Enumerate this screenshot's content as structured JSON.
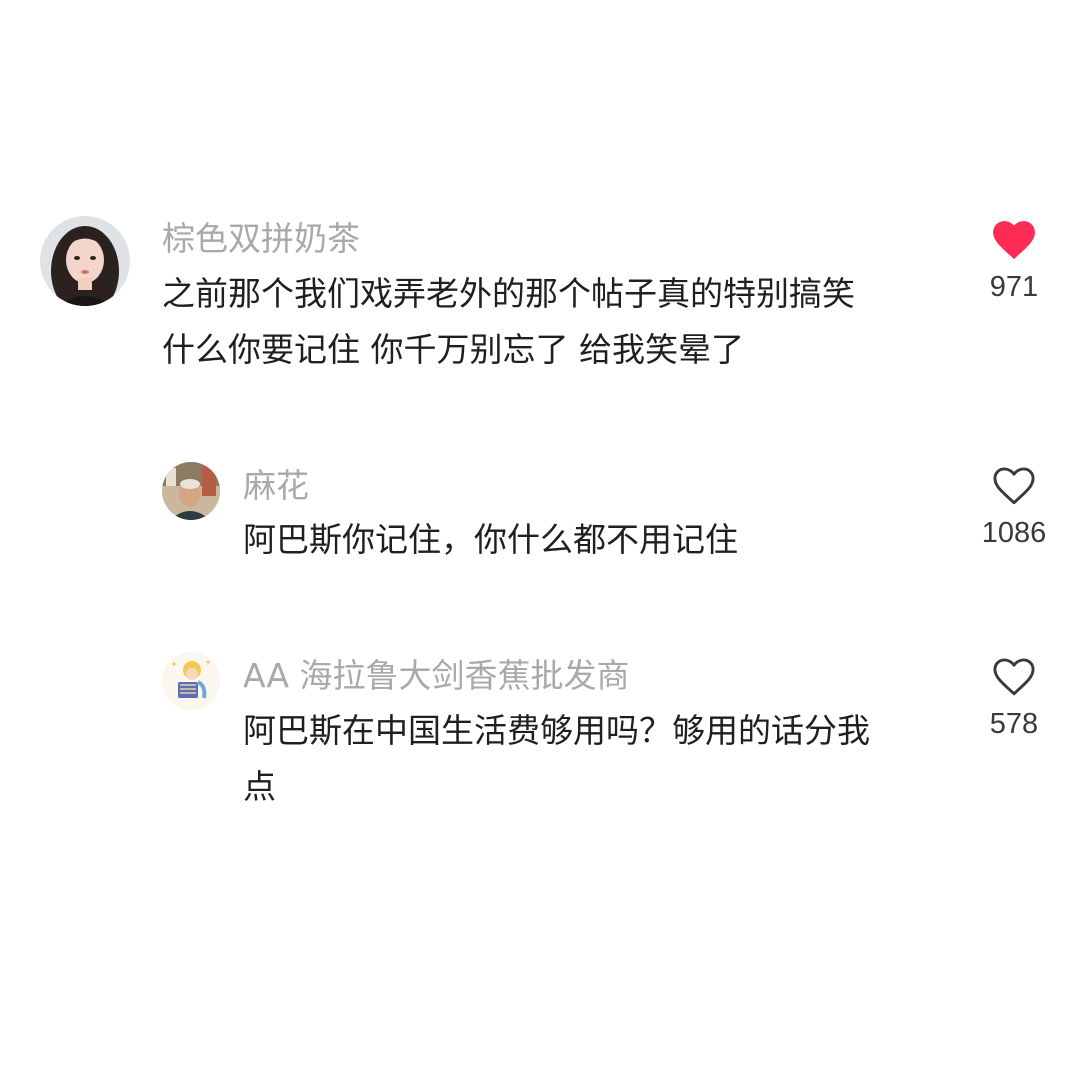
{
  "comments": [
    {
      "username": "棕色双拼奶茶",
      "text": "之前那个我们戏弄老外的那个帖子真的特别搞笑\n什么你要记住 你千万别忘了 给我笑晕了",
      "likes": "971",
      "liked": true
    },
    {
      "username": "麻花",
      "text": "阿巴斯你记住，你什么都不用记住",
      "likes": "1086",
      "liked": false
    },
    {
      "username": "AA 海拉鲁大剑香蕉批发商",
      "text": "阿巴斯在中国生活费够用吗？够用的话分我\n点",
      "likes": "578",
      "liked": false
    }
  ],
  "colors": {
    "liked_heart": "#fe2c55",
    "heart_outline": "#3a3a3a",
    "username": "#a9a9a9",
    "text": "#1f1f1f"
  }
}
